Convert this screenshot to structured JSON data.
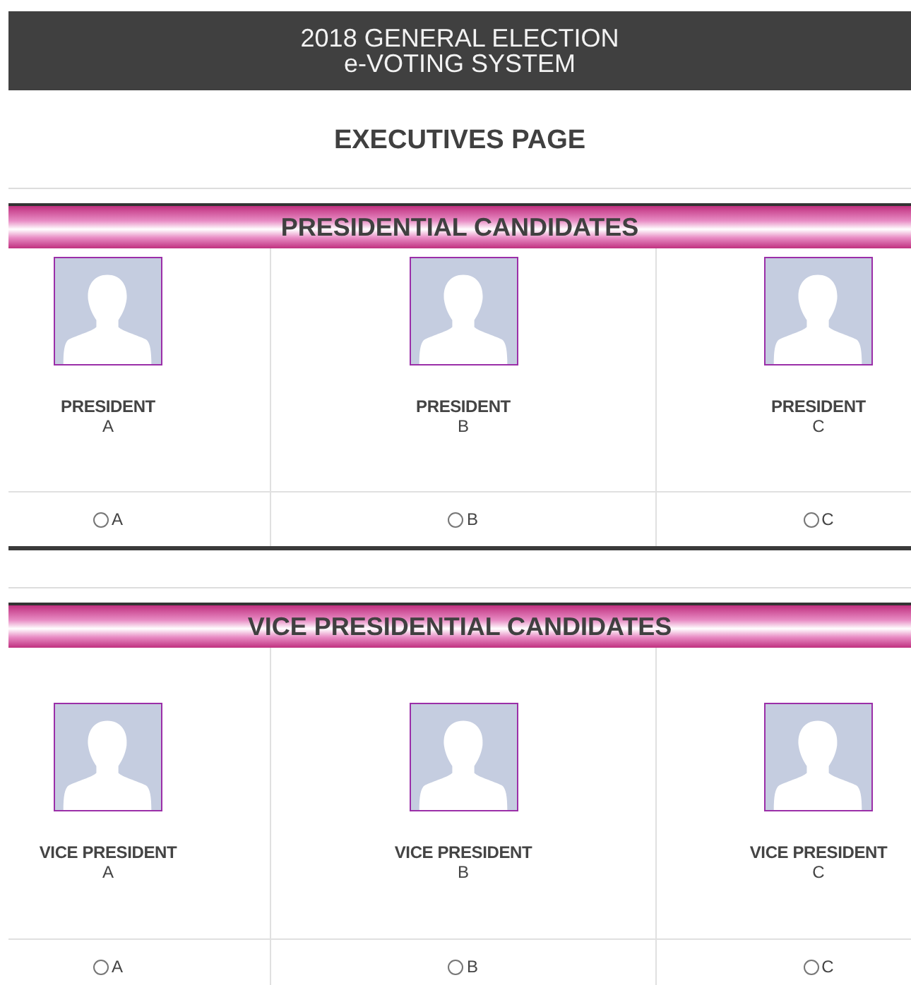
{
  "header": {
    "title_lines": [
      "2018 GENERAL ELECTION",
      "e-VOTING SYSTEM"
    ]
  },
  "page_title": "EXECUTIVES PAGE",
  "sections": [
    {
      "title": "PRESIDENTIAL CANDIDATES",
      "candidates": [
        {
          "position": "PRESIDENT",
          "name": "A",
          "option": {
            "label": "A",
            "selected": false
          }
        },
        {
          "position": "PRESIDENT",
          "name": "B",
          "option": {
            "label": "B",
            "selected": false
          }
        },
        {
          "position": "PRESIDENT",
          "name": "C",
          "option": {
            "label": "C",
            "selected": false
          }
        }
      ]
    },
    {
      "title": "VICE PRESIDENTIAL CANDIDATES",
      "candidates": [
        {
          "position": "VICE PRESIDENT",
          "name": "A",
          "option": {
            "label": "A",
            "selected": false
          }
        },
        {
          "position": "VICE PRESIDENT",
          "name": "B",
          "option": {
            "label": "B",
            "selected": false
          }
        },
        {
          "position": "VICE PRESIDENT",
          "name": "C",
          "option": {
            "label": "C",
            "selected": false
          }
        }
      ]
    }
  ]
}
